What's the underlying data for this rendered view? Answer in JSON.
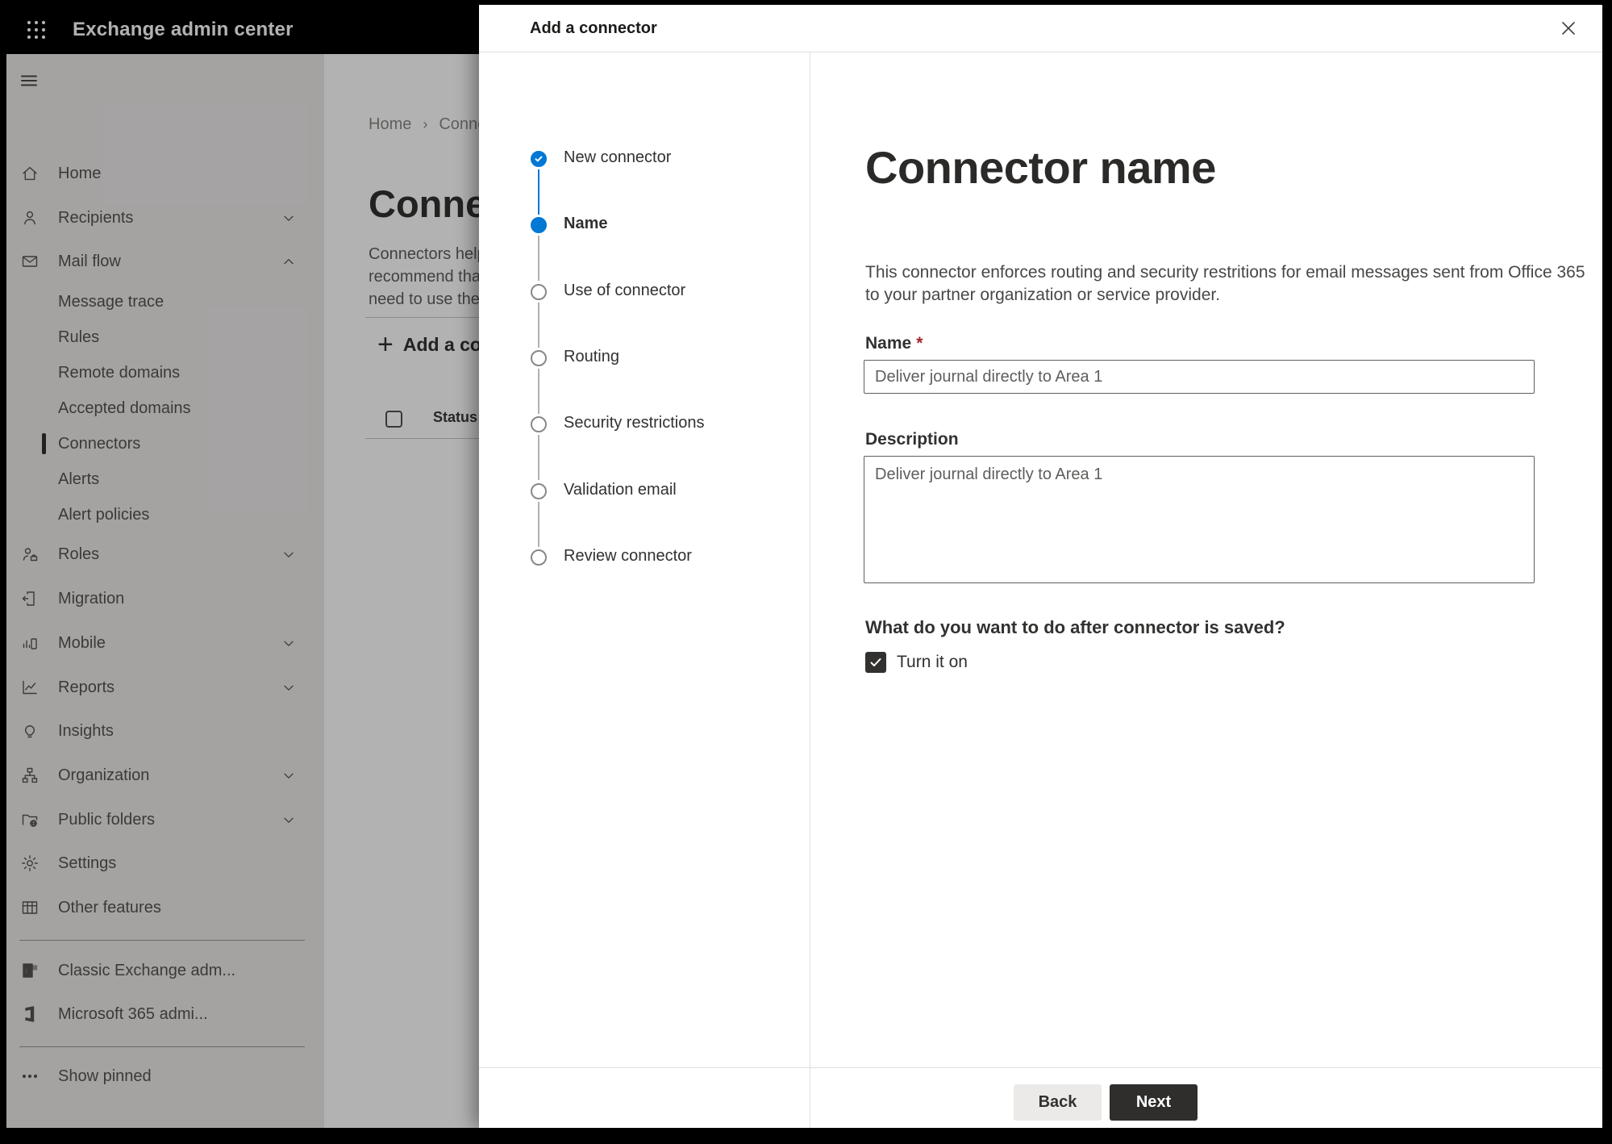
{
  "app": {
    "title": "Exchange admin center"
  },
  "sidebar": {
    "items": [
      {
        "label": "Home",
        "icon": "home"
      },
      {
        "label": "Recipients",
        "icon": "people",
        "chevron": "down"
      },
      {
        "label": "Mail flow",
        "icon": "mail",
        "chevron": "up"
      },
      {
        "label": "Message trace",
        "sub": true
      },
      {
        "label": "Rules",
        "sub": true
      },
      {
        "label": "Remote domains",
        "sub": true
      },
      {
        "label": "Accepted domains",
        "sub": true
      },
      {
        "label": "Connectors",
        "sub": true,
        "selected": true
      },
      {
        "label": "Alerts",
        "sub": true
      },
      {
        "label": "Alert policies",
        "sub": true
      },
      {
        "label": "Roles",
        "icon": "roles",
        "chevron": "down"
      },
      {
        "label": "Migration",
        "icon": "migration"
      },
      {
        "label": "Mobile",
        "icon": "mobile",
        "chevron": "down"
      },
      {
        "label": "Reports",
        "icon": "reports",
        "chevron": "down"
      },
      {
        "label": "Insights",
        "icon": "insights"
      },
      {
        "label": "Organization",
        "icon": "organization",
        "chevron": "down"
      },
      {
        "label": "Public folders",
        "icon": "public-folders",
        "chevron": "down"
      },
      {
        "label": "Settings",
        "icon": "settings"
      },
      {
        "label": "Other features",
        "icon": "other-features"
      }
    ],
    "footer_items": [
      {
        "label": "Classic Exchange adm...",
        "icon": "classic-exchange"
      },
      {
        "label": "Microsoft 365 admi...",
        "icon": "m365"
      }
    ],
    "show_pinned": {
      "label": "Show pinned",
      "icon": "ellipsis"
    }
  },
  "page": {
    "breadcrumb": {
      "home": "Home",
      "current": "Conne"
    },
    "title": "Connec",
    "intro_lines": [
      "Connectors help",
      "recommend that",
      "need to use ther"
    ],
    "add_button": "Add a conn",
    "table_header": "Status"
  },
  "panel": {
    "title": "Add a connector",
    "steps": [
      {
        "label": "New connector",
        "state": "complete"
      },
      {
        "label": "Name",
        "state": "current"
      },
      {
        "label": "Use of connector",
        "state": "upcoming"
      },
      {
        "label": "Routing",
        "state": "upcoming"
      },
      {
        "label": "Security restrictions",
        "state": "upcoming"
      },
      {
        "label": "Validation email",
        "state": "upcoming"
      },
      {
        "label": "Review connector",
        "state": "upcoming"
      }
    ],
    "heading": "Connector name",
    "intro_line1": "This connector enforces routing and security restritions for email messages sent from Office 365",
    "intro_line2": "to your partner organization or service provider.",
    "name_field": {
      "label": "Name",
      "required_mark": "*",
      "value": "Deliver journal directly to Area 1"
    },
    "description_field": {
      "label": "Description",
      "value": "Deliver journal directly to Area 1"
    },
    "question": "What do you want to do after connector is saved?",
    "turn_on": {
      "label": "Turn it on",
      "checked": true
    },
    "footer": {
      "back": "Back",
      "next": "Next"
    }
  },
  "colors": {
    "accent": "#0078d4",
    "header_bg": "#000000",
    "required": "#a4262c"
  }
}
